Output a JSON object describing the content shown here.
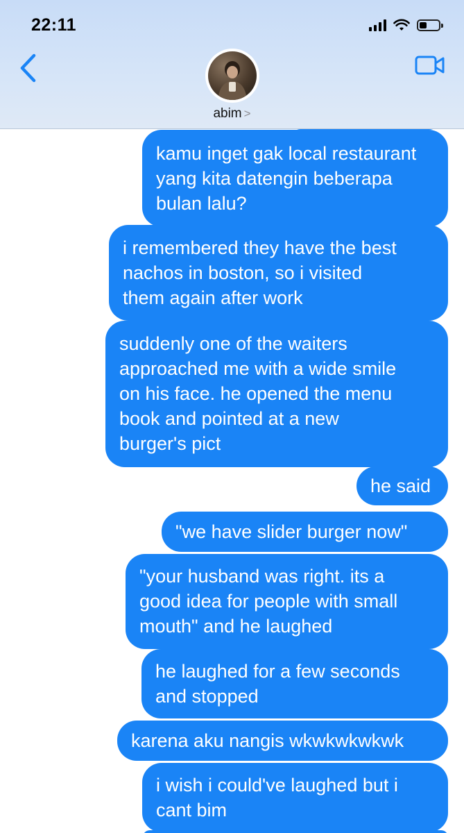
{
  "status_bar": {
    "time": "22:11"
  },
  "header": {
    "contact_name": "abim",
    "chevron": ">",
    "back_icon": "chevron-left-icon",
    "video_icon": "video-camera-icon"
  },
  "colors": {
    "bubble": "#1a84f6",
    "accent": "#1a84f6",
    "header_bg": "#d3e3f8"
  },
  "messages": [
    {
      "text": "kamu inget gak local restaurant\nyang kita datengin beberapa\nbulan lalu?"
    },
    {
      "text": "i remembered they have the best\nnachos in boston, so i visited\nthem again after work"
    },
    {
      "text": "suddenly one of the waiters\napproached me with a wide smile\non his face. he opened the menu\nbook and pointed at a new\nburger's pict"
    },
    {
      "text": "he said"
    },
    {
      "text": "\"we have slider burger now\""
    },
    {
      "text": "\"your husband was right. its a\ngood idea for people with small\nmouth\" and he laughed"
    },
    {
      "text": "he laughed for a few seconds\nand stopped"
    },
    {
      "text": "karena aku nangis wkwkwkwkwk"
    },
    {
      "text": "i wish i could've laughed but i\ncant bim"
    }
  ]
}
